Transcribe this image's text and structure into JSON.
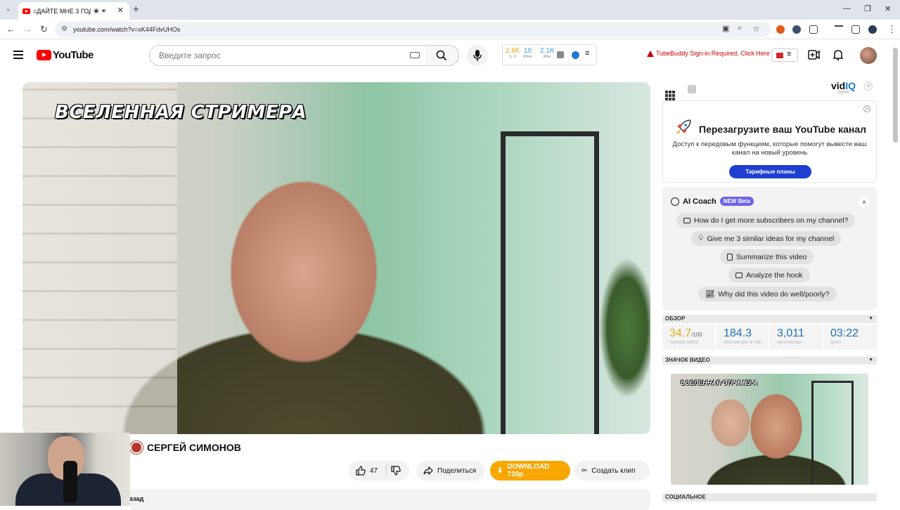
{
  "browser": {
    "tab_title": "=ДАЙТЕ МНЕ 3 ГОДА= ",
    "url": "youtube.com/watch?v=xK44FdvUHOs"
  },
  "youtube": {
    "logo": "YouTube",
    "search_placeholder": "Введите запрос",
    "stats": [
      {
        "value": "2.8K",
        "label": "1г",
        "accent": "#e6a817"
      },
      {
        "value": "10",
        "label": "60мн",
        "accent": "#3d9be9"
      },
      {
        "value": "2.1K",
        "label": "48чс",
        "accent": "#3d9be9"
      }
    ],
    "tubebuddy_warning": "TubeBuddy Sign-in Required, Click Here"
  },
  "video": {
    "overlay_title": "ВСЕЛЕННАЯ СТРИМЕРА",
    "channel_name": "СЕРГЕЙ СИМОНОВ",
    "likes": "47",
    "share_label": "Поделиться",
    "download_label": "DOWNLOAD 720p",
    "clip_label": "Создать клип",
    "description_fragment": "азад"
  },
  "vidiq": {
    "logo_a": "vid",
    "logo_b": "IQ",
    "plan": "basic",
    "promo": {
      "title": "Перезагрузите ваш YouTube канал",
      "subtitle": "Доступ к передовым функциям, которые помогут вывести ваш канал на новый уровень",
      "button": "Тарифные планы"
    },
    "ai_coach": {
      "title": "AI Coach",
      "badge": "NEW Beta",
      "prompts": [
        "How do I get more subscribers on my channel?",
        "Give me 3 similar ideas for my channel",
        "Summarize this video",
        "Analyze the hook",
        "Why did this video do well/poorly?"
      ]
    },
    "overview": {
      "header": "ОБЗОР",
      "metrics": [
        {
          "value": "34.7",
          "suffix": "/100",
          "label": "оценка vidIQ"
        },
        {
          "value": "184.3",
          "suffix": "",
          "label": "просмотры в час"
        },
        {
          "value": "3,011",
          "suffix": "",
          "label": "просмотры"
        },
        {
          "value": "03:22",
          "suffix": "",
          "label": "длит"
        }
      ]
    },
    "thumbnail_header": "ЗНАЧОК ВИДЕО",
    "thumbnail_text": "ВСЕЛЕННАЯ СТРИМЕРА",
    "social_header": "СОЦИАЛЬНОЕ"
  }
}
